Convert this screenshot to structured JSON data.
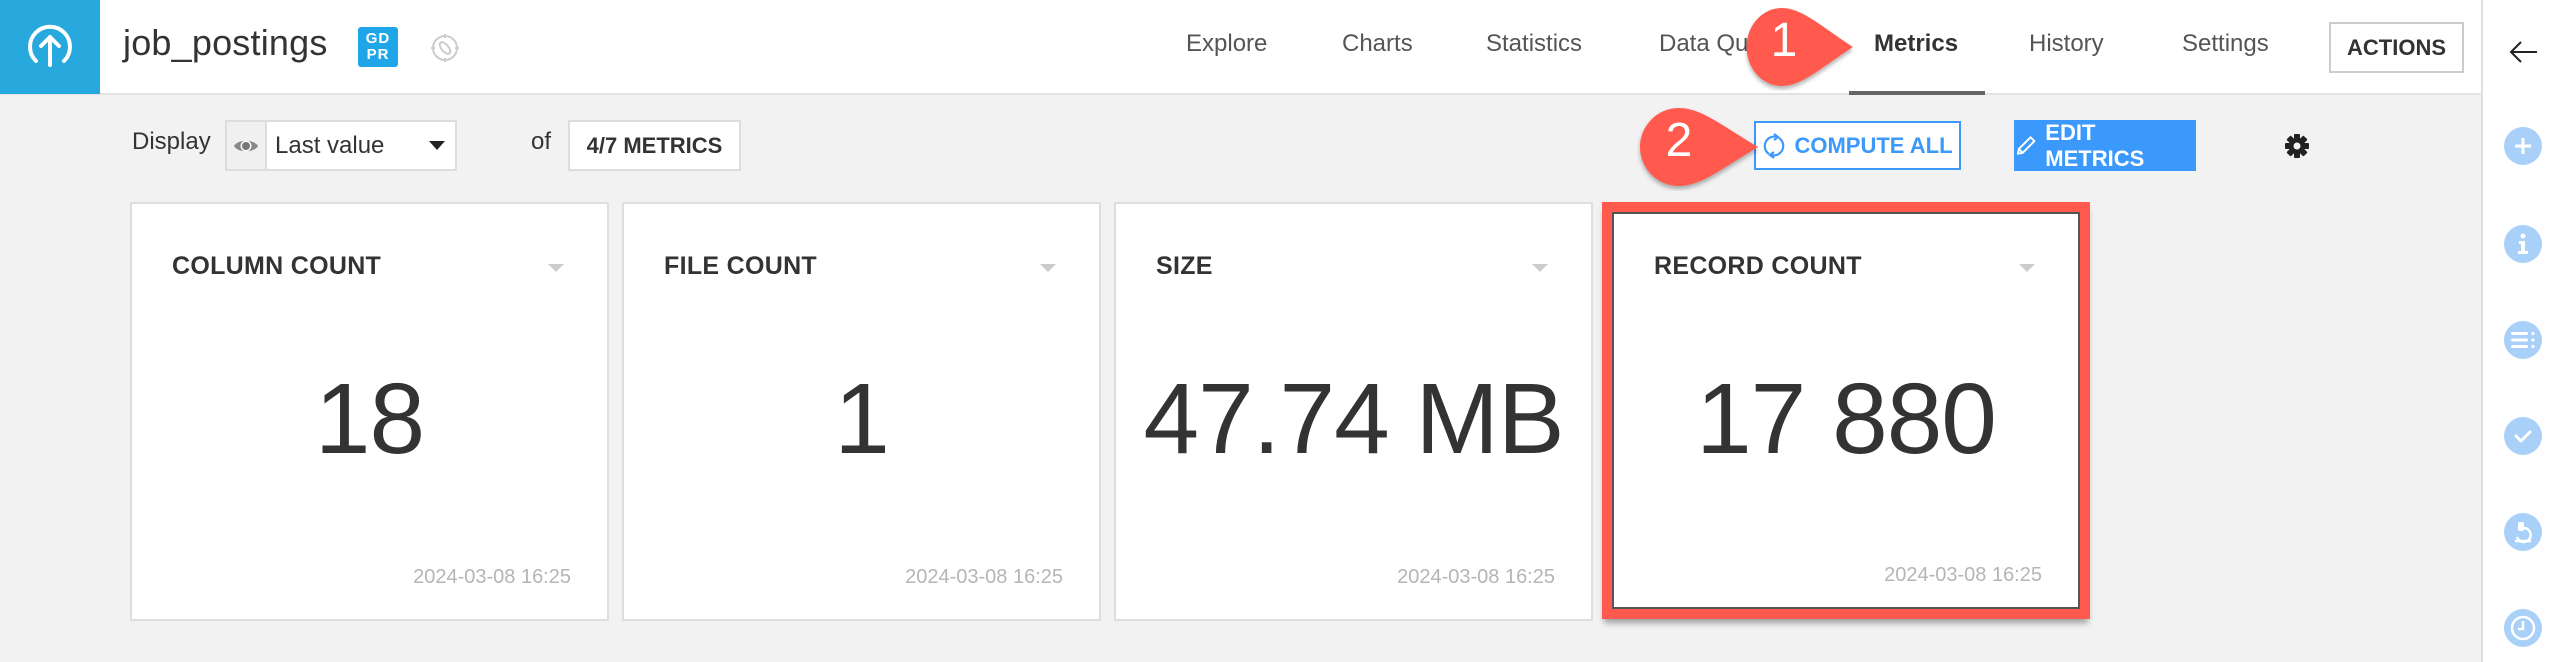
{
  "header": {
    "dataset_name": "job_postings",
    "gdpr_badge_line1": "GD",
    "gdpr_badge_line2": "PR",
    "logo_icon": "upload-arrow-icon",
    "lineage_icon": "lineage-icon",
    "tabs": [
      {
        "label": "Explore",
        "active": false
      },
      {
        "label": "Charts",
        "active": false
      },
      {
        "label": "Statistics",
        "active": false
      },
      {
        "label": "Data Qu",
        "active": false
      },
      {
        "label": "Metrics",
        "active": true
      },
      {
        "label": "History",
        "active": false
      },
      {
        "label": "Settings",
        "active": false
      }
    ],
    "actions_label": "ACTIONS"
  },
  "toolbar": {
    "display_label": "Display",
    "display_select_value": "Last value",
    "of_label": "of",
    "metrics_selector_label": "4/7 METRICS",
    "compute_all_label": "COMPUTE ALL",
    "edit_metrics_label": "EDIT METRICS"
  },
  "metrics": [
    {
      "title": "COLUMN COUNT",
      "value": "18",
      "timestamp": "2024-03-08 16:25",
      "highlighted": false
    },
    {
      "title": "FILE COUNT",
      "value": "1",
      "timestamp": "2024-03-08 16:25",
      "highlighted": false
    },
    {
      "title": "SIZE",
      "value": "47.74 MB",
      "timestamp": "2024-03-08 16:25",
      "highlighted": false
    },
    {
      "title": "RECORD COUNT",
      "value": "17 880",
      "timestamp": "2024-03-08 16:25",
      "highlighted": true
    }
  ],
  "annotations": [
    {
      "number": "1",
      "target": "Metrics tab"
    },
    {
      "number": "2",
      "target": "COMPUTE ALL button"
    }
  ],
  "right_sidebar": {
    "icons": [
      "back-arrow-icon",
      "plus-icon",
      "info-icon",
      "list-icon",
      "check-icon",
      "lab-icon",
      "clock-icon"
    ]
  },
  "colors": {
    "brand_blue": "#28a9dd",
    "primary_button": "#3b99fc",
    "annotation_red": "#ff5a4d",
    "sidebar_icon": "#a8d0f8"
  }
}
